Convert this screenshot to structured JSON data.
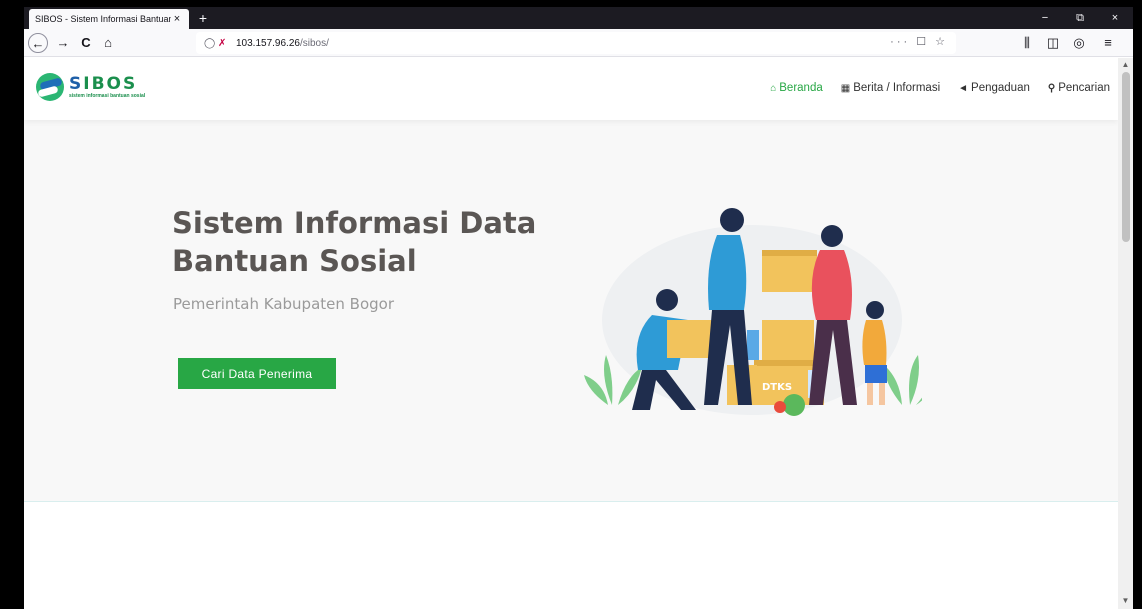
{
  "browser": {
    "tab_title": "SIBOS - Sistem Informasi Bantuan S",
    "tab_close": "×",
    "new_tab": "+",
    "controls": {
      "minimize": "−",
      "restore": "⧉",
      "close": "×"
    },
    "nav": {
      "back": "←",
      "forward": "→",
      "reload": "C",
      "home": "⌂"
    },
    "url": {
      "host": "103.157.96.26",
      "path": "/sibos/",
      "actions": "··· ☐ ☆"
    },
    "right_icons": [
      "library-icon",
      "sidebar-icon",
      "account-icon",
      "menu-icon"
    ],
    "right_glyphs": [
      "⫼",
      "◫",
      "◎",
      "≡"
    ]
  },
  "site": {
    "logo": {
      "name_part1": "S",
      "name_part2": "IBOS",
      "tagline": "sistem informasi bantuan sosial"
    },
    "nav": [
      {
        "icon": "home-icon",
        "glyph": "⌂",
        "label": "Beranda",
        "active": true
      },
      {
        "icon": "news-icon",
        "glyph": "▦",
        "label": "Berita / Informasi",
        "active": false
      },
      {
        "icon": "megaphone-icon",
        "glyph": "◄",
        "label": "Pengaduan",
        "active": false
      },
      {
        "icon": "search-icon",
        "glyph": "⚲",
        "label": "Pencarian",
        "active": false
      }
    ],
    "hero": {
      "title": "Sistem Informasi Data Bantuan Sosial",
      "subtitle": "Pemerintah Kabupaten Bogor",
      "cta_label": "Cari Data Penerima",
      "box_label": "DTKS"
    }
  },
  "colors": {
    "accent": "#28a745",
    "brand_blue": "#1e5fa8",
    "hero_bg": "#f8f8f8"
  }
}
